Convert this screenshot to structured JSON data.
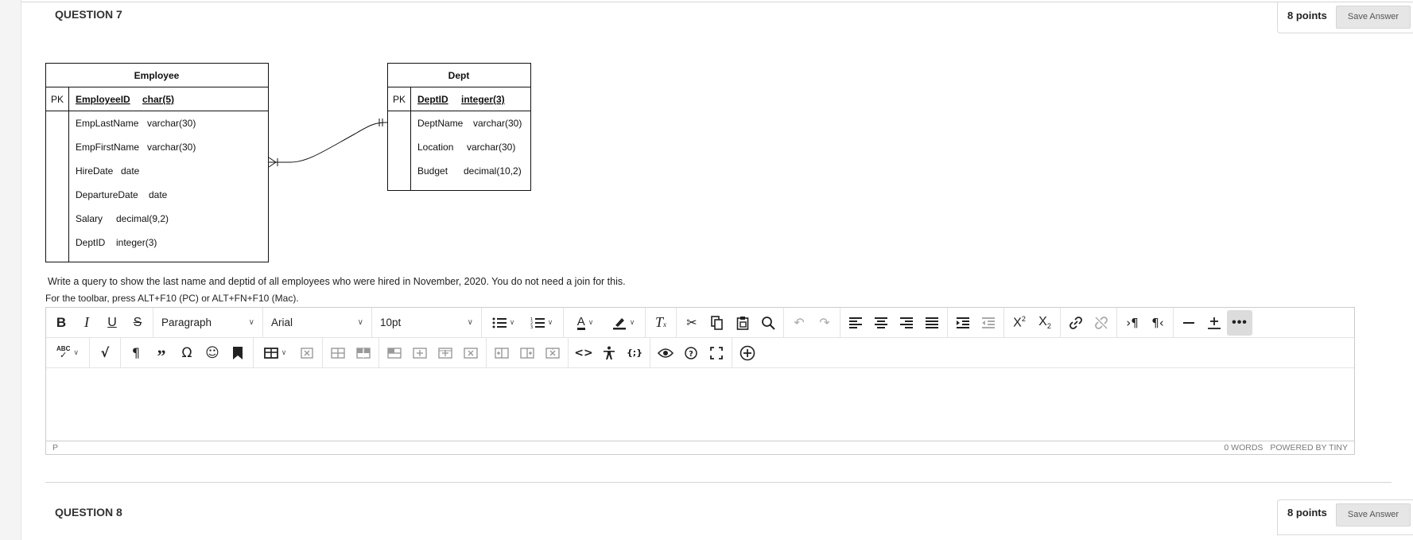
{
  "question7": {
    "title": "QUESTION 7",
    "points": "8 points",
    "save_label": "Save Answer"
  },
  "diagram": {
    "employee": {
      "name": "Employee",
      "pk_label": "PK",
      "pk_field": "EmployeeID",
      "pk_type": "char(5)",
      "fields": [
        {
          "name": "EmpLastName",
          "type": "varchar(30)"
        },
        {
          "name": "EmpFirstName",
          "type": "varchar(30)"
        },
        {
          "name": "HireDate",
          "type": "date"
        },
        {
          "name": "DepartureDate",
          "type": "date"
        },
        {
          "name": "Salary",
          "type": "decimal(9,2)"
        },
        {
          "name": "DeptID",
          "type": "integer(3)"
        }
      ]
    },
    "dept": {
      "name": "Dept",
      "pk_label": "PK",
      "pk_field": "DeptID",
      "pk_type": "integer(3)",
      "fields": [
        {
          "name": "DeptName",
          "type": "varchar(30)"
        },
        {
          "name": "Location",
          "type": "varchar(30)"
        },
        {
          "name": "Budget",
          "type": "decimal(10,2)"
        }
      ]
    }
  },
  "prompt": "Write a query to show the last name and deptid of all employees who were hired in November, 2020.  You do not need a join for this.",
  "hint": "For the toolbar, press ALT+F10 (PC) or ALT+FN+F10 (Mac).",
  "editor": {
    "block_format": "Paragraph",
    "font_family": "Arial",
    "font_size": "10pt",
    "status_path": "P",
    "word_count": "0 WORDS",
    "powered_by": "POWERED BY TINY",
    "content": ""
  },
  "question8": {
    "title": "QUESTION 8",
    "points": "8 points",
    "save_label": "Save Answer"
  }
}
